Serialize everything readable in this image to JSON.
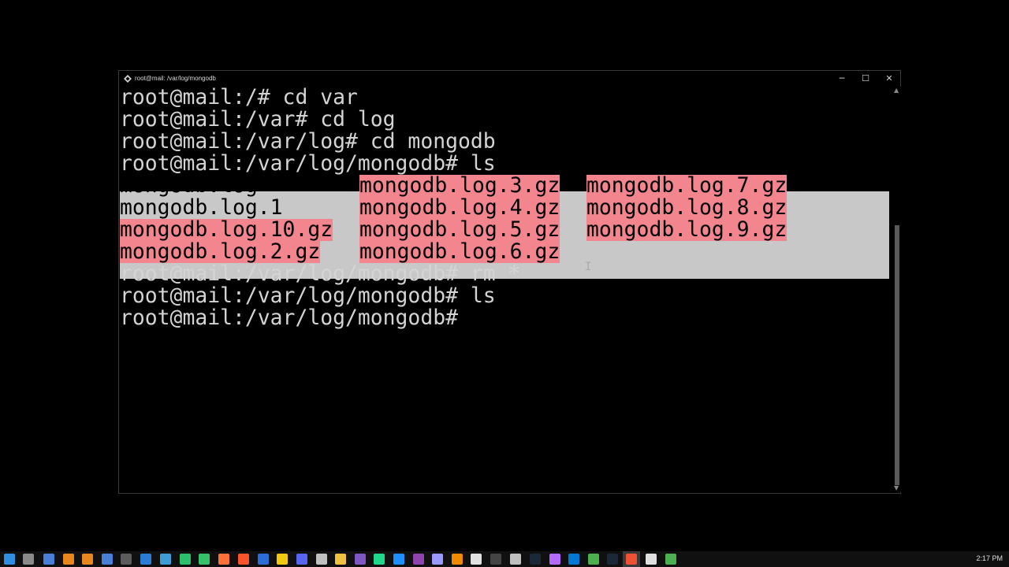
{
  "window": {
    "title": "root@mail: /var/log/mongodb",
    "min_glyph": "─",
    "max_glyph": "☐",
    "close_glyph": "✕"
  },
  "terminal": {
    "lines": [
      "root@mail:/# cd var",
      "root@mail:/var# cd log",
      "root@mail:/var/log# cd mongodb",
      "root@mail:/var/log/mongodb# ls"
    ],
    "ls_output": {
      "col1": [
        "mongodb.log",
        "mongodb.log.1",
        "mongodb.log.10.gz",
        "mongodb.log.2.gz"
      ],
      "col2": [
        "mongodb.log.3.gz",
        "mongodb.log.4.gz",
        "mongodb.log.5.gz",
        "mongodb.log.6.gz"
      ],
      "col3": [
        "mongodb.log.7.gz",
        "mongodb.log.8.gz",
        "mongodb.log.9.gz"
      ]
    },
    "after_lines": [
      "root@mail:/var/log/mongodb# rm *",
      "root@mail:/var/log/mongodb# ls",
      "root@mail:/var/log/mongodb#"
    ]
  },
  "colors": {
    "selection": "#c8c8c8",
    "gz_highlight": "#f3858f",
    "terminal_text": "#d4d4d4"
  },
  "taskbar": {
    "clock": "2:17 PM",
    "icons": [
      "windows-start-icon",
      "task-view-icon",
      "file-icon",
      "blender-icon",
      "blender2-icon",
      "app-icon",
      "terminal-icon",
      "edge-icon",
      "app-icon",
      "clion-icon",
      "notepad-icon",
      "firefox-icon",
      "brave-icon",
      "word-icon",
      "notes-icon",
      "discord-icon",
      "app-icon",
      "folder-icon",
      "vs-icon",
      "pycharm-icon",
      "webstorm-icon",
      "vs-purple-icon",
      "premiere-icon",
      "vlc-icon",
      "obs-icon",
      "cmd-icon",
      "terminal-icon",
      "steam-icon",
      "phpstorm-icon",
      "vscode-icon",
      "chrome-icon",
      "steam2-icon",
      "git-icon",
      "notepad2-icon",
      "chrome2-icon"
    ]
  }
}
